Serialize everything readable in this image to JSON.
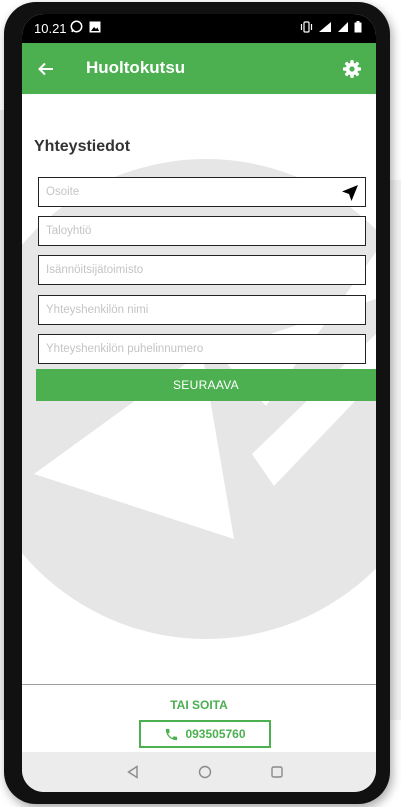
{
  "status_bar": {
    "time": "10.21"
  },
  "app_bar": {
    "title": "Huoltokutsu",
    "back_icon": "arrow-back-icon",
    "settings_icon": "gear-icon"
  },
  "form": {
    "section_title": "Yhteystiedot",
    "fields": [
      {
        "placeholder": "Osoite",
        "value": ""
      },
      {
        "placeholder": "Taloyhtiö",
        "value": ""
      },
      {
        "placeholder": "Isännöitsijätoimisto",
        "value": ""
      },
      {
        "placeholder": "Yhteyshenkilön nimi",
        "value": ""
      },
      {
        "placeholder": "Yhteyshenkilön puhelinnumero",
        "value": ""
      }
    ],
    "submit_label": "SEURAAVA"
  },
  "call": {
    "label": "TAI SOITA",
    "phone": "093505760"
  },
  "colors": {
    "primary": "#4caf50",
    "status_bar": "#000000",
    "nav_bar": "#ececec"
  }
}
